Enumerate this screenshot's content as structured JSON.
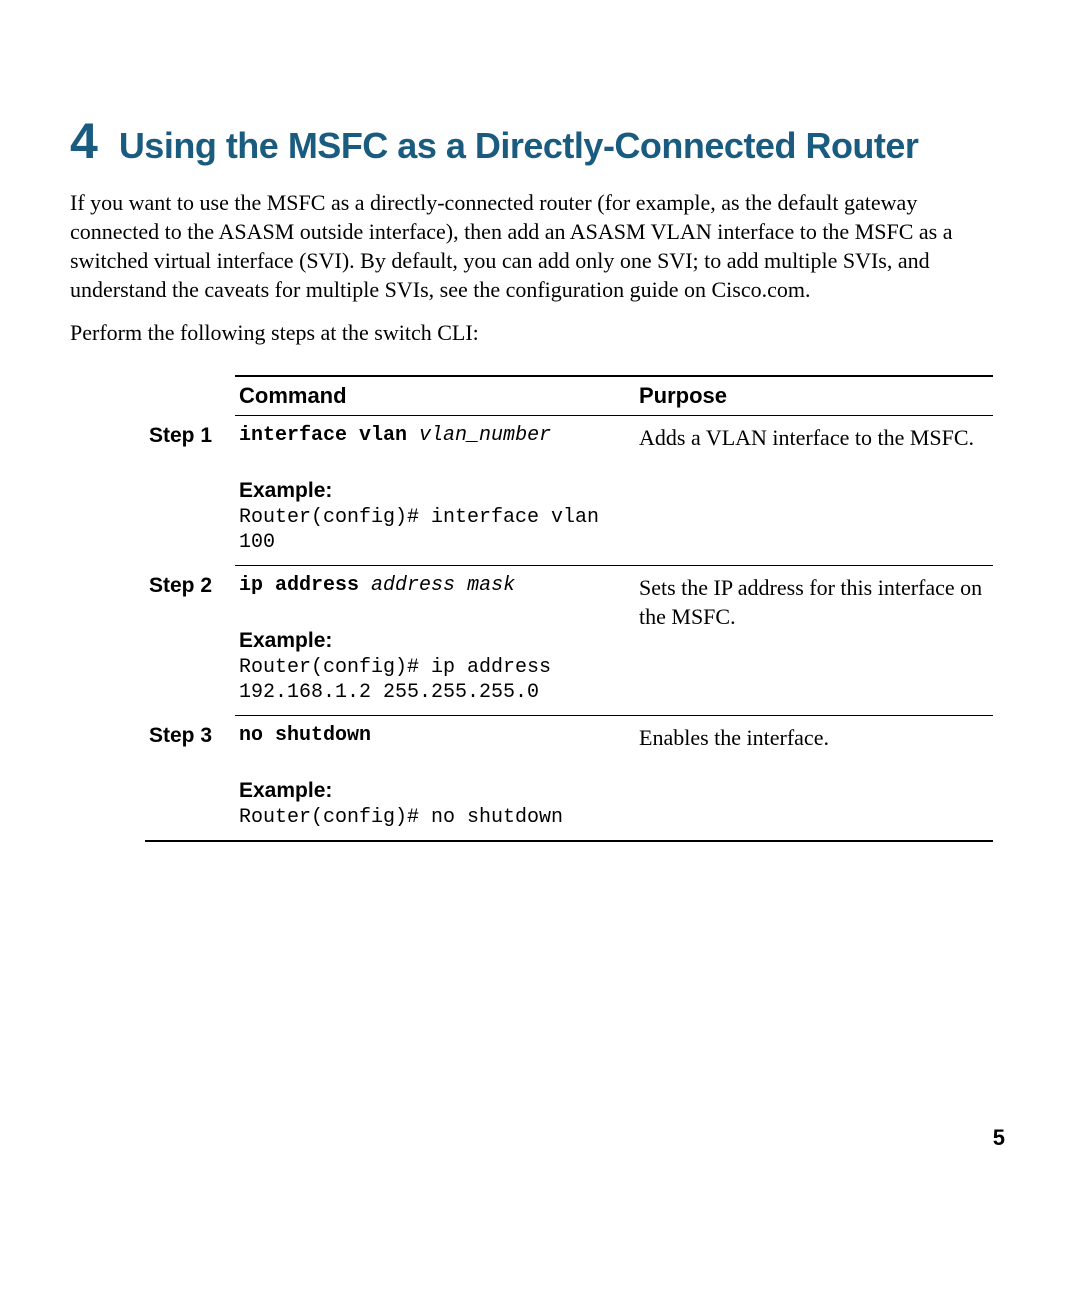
{
  "section": {
    "number": "4",
    "title": "Using the MSFC as a Directly-Connected Router"
  },
  "paragraphs": {
    "intro": "If you want to use the MSFC as a directly-connected router (for example, as the default gateway connected to the ASASM outside interface), then add an ASASM VLAN interface to the MSFC as a switched virtual interface (SVI). By default, you can add only one SVI; to add multiple SVIs, and understand the caveats for multiple SVIs, see the configuration guide on Cisco.com.",
    "lead": "Perform the following steps at the switch CLI:"
  },
  "table": {
    "headers": {
      "command": "Command",
      "purpose": "Purpose"
    },
    "example_label": "Example:",
    "steps": [
      {
        "label": "Step 1",
        "command_bold": "interface vlan",
        "command_arg": "vlan_number",
        "example": "Router(config)# interface vlan 100",
        "purpose": "Adds a VLAN interface to the MSFC."
      },
      {
        "label": "Step 2",
        "command_bold": "ip address",
        "command_arg": "address mask",
        "example": "Router(config)# ip address 192.168.1.2 255.255.255.0",
        "purpose": "Sets the IP address for this interface on the MSFC."
      },
      {
        "label": "Step 3",
        "command_bold": "no shutdown",
        "command_arg": "",
        "example": "Router(config)# no shutdown",
        "purpose": "Enables the interface."
      }
    ]
  },
  "page_number": "5"
}
